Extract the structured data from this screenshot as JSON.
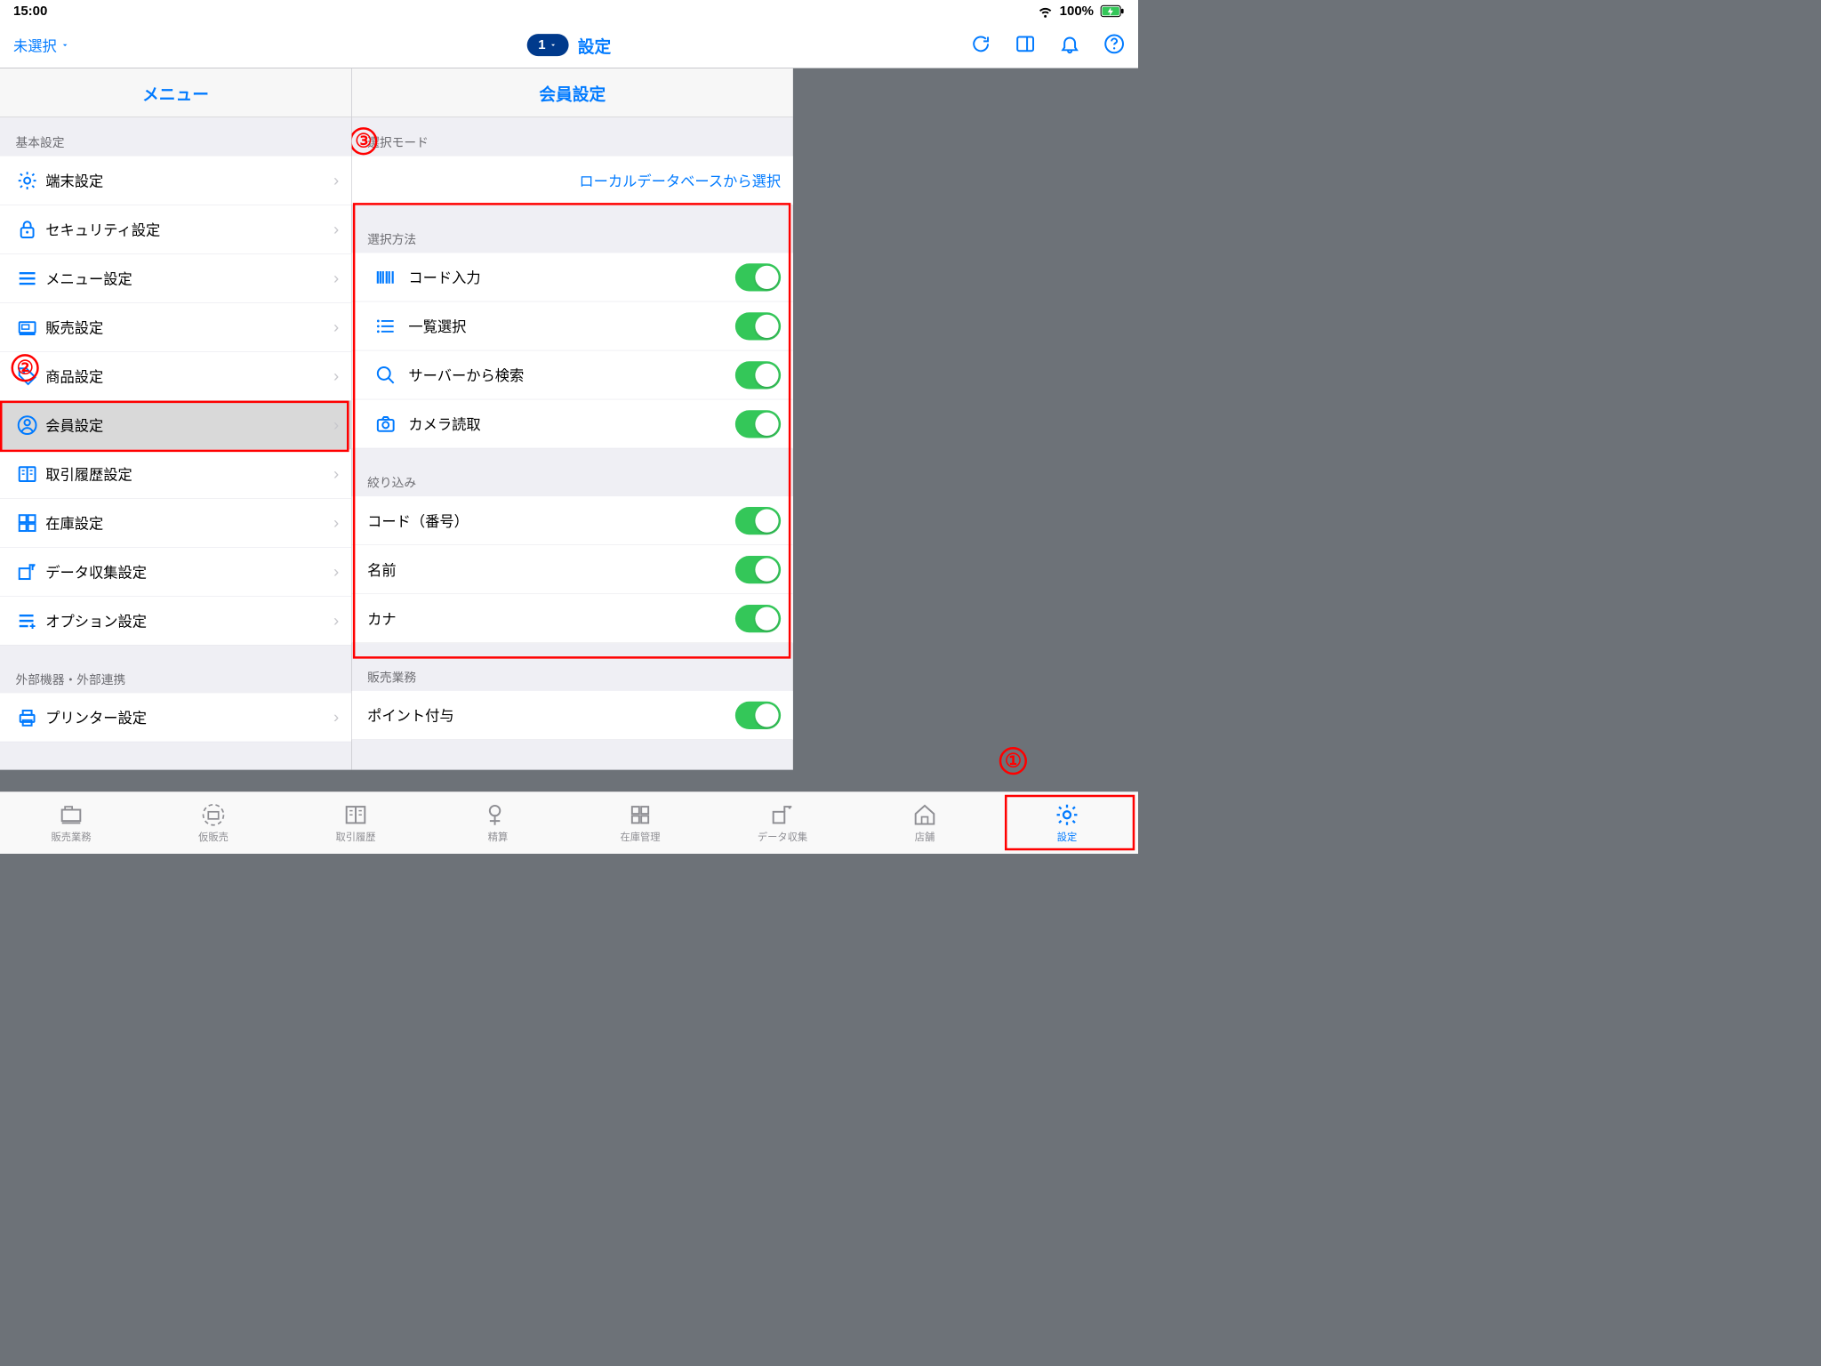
{
  "status_bar": {
    "time": "15:00",
    "battery_pct": "100%"
  },
  "nav": {
    "segment_label": "未選択",
    "badge": "1",
    "title": "設定"
  },
  "columns": {
    "left_header": "メニュー",
    "right_header": "会員設定"
  },
  "menu": {
    "section_basic": "基本設定",
    "items": [
      "端末設定",
      "セキュリティ設定",
      "メニュー設定",
      "販売設定",
      "商品設定",
      "会員設定",
      "取引履歴設定",
      "在庫設定",
      "データ収集設定",
      "オプション設定"
    ],
    "section_external": "外部機器・外部連携",
    "items_ext": [
      "プリンター設定"
    ]
  },
  "detail": {
    "sec_mode": "選択モード",
    "mode_link": "ローカルデータベースから選択",
    "sec_method": "選択方法",
    "methods": [
      "コード入力",
      "一覧選択",
      "サーバーから検索",
      "カメラ読取"
    ],
    "sec_filter": "絞り込み",
    "filters": [
      "コード（番号）",
      "名前",
      "カナ"
    ],
    "sec_sales": "販売業務",
    "sales": [
      "ポイント付与"
    ]
  },
  "tabs": [
    "販売業務",
    "仮販売",
    "取引履歴",
    "精算",
    "在庫管理",
    "データ収集",
    "店舗",
    "設定"
  ],
  "anno": {
    "a1": "①",
    "a2": "②",
    "a3": "③"
  }
}
